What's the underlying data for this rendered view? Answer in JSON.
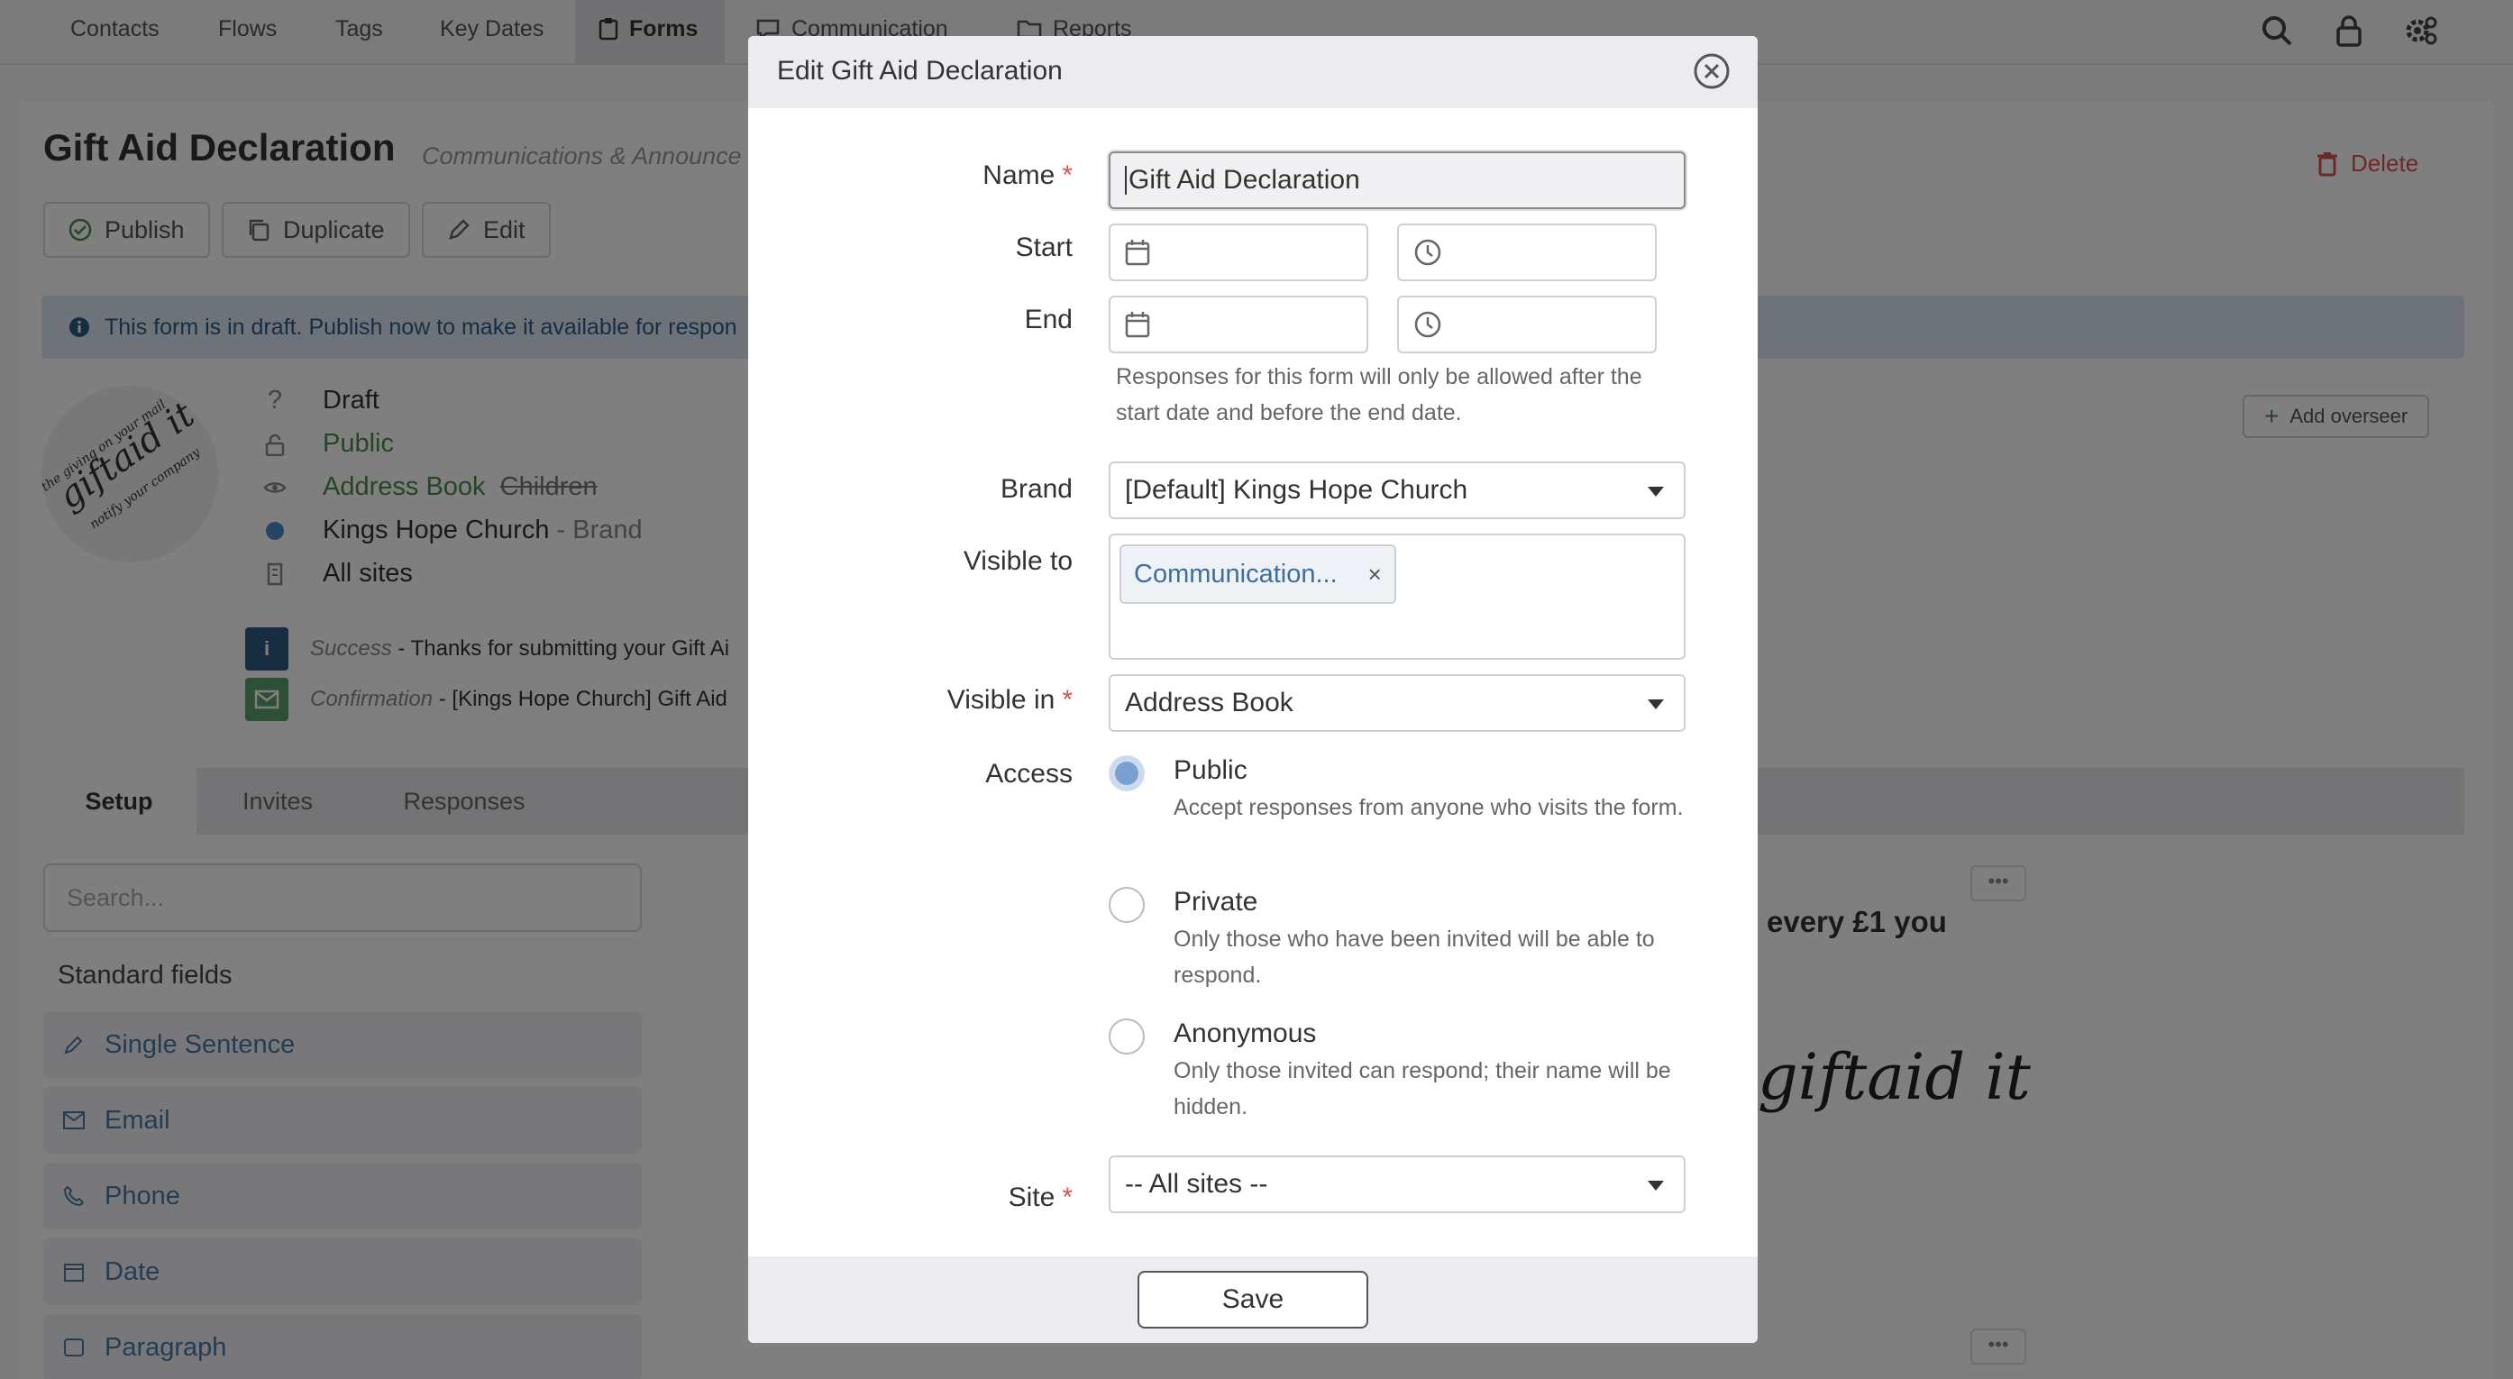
{
  "nav": {
    "items": [
      "Contacts",
      "Flows",
      "Tags",
      "Key Dates",
      "Forms",
      "Communication",
      "Reports"
    ],
    "active": "Forms"
  },
  "page": {
    "title": "Gift Aid Declaration",
    "subtitle": "Communications & Announce",
    "delete_label": "Delete",
    "publish_label": "Publish",
    "duplicate_label": "Duplicate",
    "edit_label": "Edit",
    "info_text": "This form is in draft. Publish now to make it available for respon",
    "status": "Draft",
    "access": "Public",
    "visible_in": "Address Book",
    "visible_in_struck": "Children",
    "brand": "Kings Hope Church",
    "brand_suffix": "- Brand",
    "sites": "All sites",
    "success_label": "Success",
    "success_text": "- Thanks for submitting your Gift Ai",
    "confirmation_label": "Confirmation",
    "confirmation_text": "- [Kings Hope Church] Gift Aid",
    "add_overseer": "Add overseer",
    "tabs": [
      "Setup",
      "Invites",
      "Responses"
    ],
    "search_placeholder": "Search...",
    "standard_fields_heading": "Standard fields",
    "fields": [
      "Single Sentence",
      "Email",
      "Phone",
      "Date",
      "Paragraph"
    ],
    "canvas_text": "every £1 you",
    "canvas_logo": "giftaid it"
  },
  "modal": {
    "title": "Edit Gift Aid Declaration",
    "name_label": "Name",
    "name_value": "Gift Aid Declaration",
    "start_label": "Start",
    "end_label": "End",
    "date_help": "Responses for this form will only be allowed after the start date and before the end date.",
    "brand_label": "Brand",
    "brand_value": "[Default] Kings Hope Church",
    "visible_to_label": "Visible to",
    "visible_to_tag": "Communication...",
    "visible_in_label": "Visible in",
    "visible_in_value": "Address Book",
    "access_label": "Access",
    "access_options": [
      {
        "title": "Public",
        "desc": "Accept responses from anyone who visits the form.",
        "checked": true
      },
      {
        "title": "Private",
        "desc": "Only those who have been invited will be able to respond.",
        "checked": false
      },
      {
        "title": "Anonymous",
        "desc": "Only those invited can respond; their name will be hidden.",
        "checked": false
      }
    ],
    "site_label": "Site",
    "site_value": "-- All sites --",
    "save_label": "Save"
  },
  "colors": {
    "required": "#d9534f",
    "accent": "#7aa0cf",
    "overlay": "rgba(0,0,0,0.5)"
  }
}
